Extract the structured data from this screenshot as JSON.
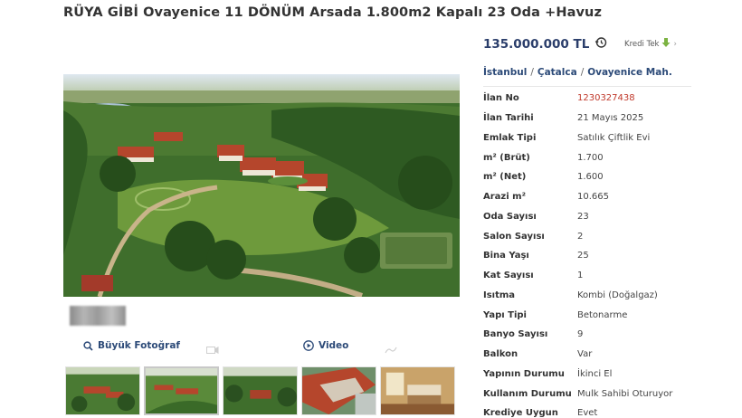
{
  "listing": {
    "title": "RÜYA GİBİ Ovayenice 11 DÖNÜM Arsada 1.800m2 Kapalı 23 Oda +Havuz",
    "price": "135.000.000 TL",
    "kredi_label": "Kredi Tek"
  },
  "breadcrumb": {
    "items": [
      "İstanbul",
      "Çatalca",
      "Ovayenice Mah."
    ],
    "separator": "/"
  },
  "details": [
    {
      "label": "İlan No",
      "value": "1230327438"
    },
    {
      "label": "İlan Tarihi",
      "value": "21 Mayıs 2025"
    },
    {
      "label": "Emlak Tipi",
      "value": "Satılık Çiftlik Evi"
    },
    {
      "label": "m² (Brüt)",
      "value": "1.700"
    },
    {
      "label": "m² (Net)",
      "value": "1.600"
    },
    {
      "label": "Arazi m²",
      "value": "10.665"
    },
    {
      "label": "Oda Sayısı",
      "value": "23"
    },
    {
      "label": "Salon Sayısı",
      "value": "2"
    },
    {
      "label": "Bina Yaşı",
      "value": "25"
    },
    {
      "label": "Kat Sayısı",
      "value": "1"
    },
    {
      "label": "Isıtma",
      "value": "Kombi (Doğalgaz)"
    },
    {
      "label": "Yapı Tipi",
      "value": "Betonarme"
    },
    {
      "label": "Banyo Sayısı",
      "value": "9"
    },
    {
      "label": "Balkon",
      "value": "Var"
    },
    {
      "label": "Yapının Durumu",
      "value": "İkinci El"
    },
    {
      "label": "Kullanım Durumu",
      "value": "Mulk Sahibi Oturuyor"
    },
    {
      "label": "Krediye Uygun",
      "value": "Evet"
    }
  ],
  "media": {
    "big_photo_label": "Büyük Fotoğraf",
    "video_label": "Video"
  },
  "colors": {
    "link": "#2c4a78",
    "price": "#2b3e6b",
    "listing_no": "#c0392b",
    "kredi_arrow": "#7cb342"
  },
  "icons": {
    "price_history": "clock-history-icon",
    "kredi": "arrow-down-icon",
    "big_photo": "search-icon",
    "video": "play-circle-icon"
  }
}
